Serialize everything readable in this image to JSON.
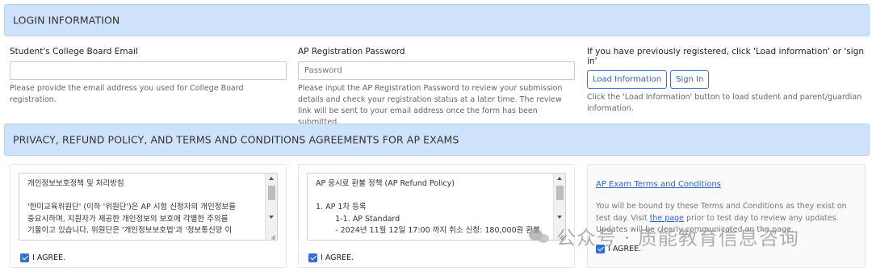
{
  "login_section": {
    "title": "LOGIN INFORMATION",
    "email": {
      "label": "Student's College Board Email",
      "value": "",
      "placeholder": "",
      "help": "Please provide the email address you used for College Board registration."
    },
    "password": {
      "label": "AP Registration Password",
      "placeholder": "Password",
      "help": "Please input the AP Registration Password to review your submission details and check your registration status at a later time. The review link will be sent to your email address once the form has been submitted."
    },
    "previous": {
      "label": "If you have previously registered, click 'Load information' or 'sign in'",
      "load_button": "Load Information",
      "signin_button": "Sign In",
      "help": "Click the 'Load Information' button to load student and parent/guardian information."
    }
  },
  "agreements_section": {
    "title": "PRIVACY, REFUND POLICY, AND TERMS AND CONDITIONS AGREEMENTS FOR AP EXAMS",
    "privacy_panel": {
      "text": "개인정보보호정책 및 처리방침\n\n'한미교육위원단' (이하 '위원단')은 AP 시험 신청자의 개인정보를\n중요시하며, 지원자가 제공한 개인정보의 보호에 각별한 주의를\n기울이고 있습니다. 위원단은 '개인정보보호법'과 '정보통신망 이",
      "agree_label": "I AGREE."
    },
    "refund_panel": {
      "text": "AP 응시료 환불 정책 (AP Refund Policy)\n\n1. AP 1차 등록\n        1-1. AP Standard\n        - 2024년 11월 12일 17:00 까지 취소 신청: 180,000원 환불",
      "agree_label": "I AGREE."
    },
    "terms_panel": {
      "link_title": "AP Exam Terms and Conditions",
      "text_before": "You will be bound by these Terms and Conditions as they exist on test day. Visit ",
      "inline_link": "the page",
      "text_after": " prior to test day to review any updates. Updates will be clearly communicated on the page.",
      "agree_label": "I AGREE."
    }
  },
  "watermark": {
    "text": "公众号 · 质能教育信息咨询"
  },
  "colors": {
    "section_bar": "#cfe2fb",
    "accent": "#2e64c8",
    "checkbox": "#2f6fd6"
  }
}
